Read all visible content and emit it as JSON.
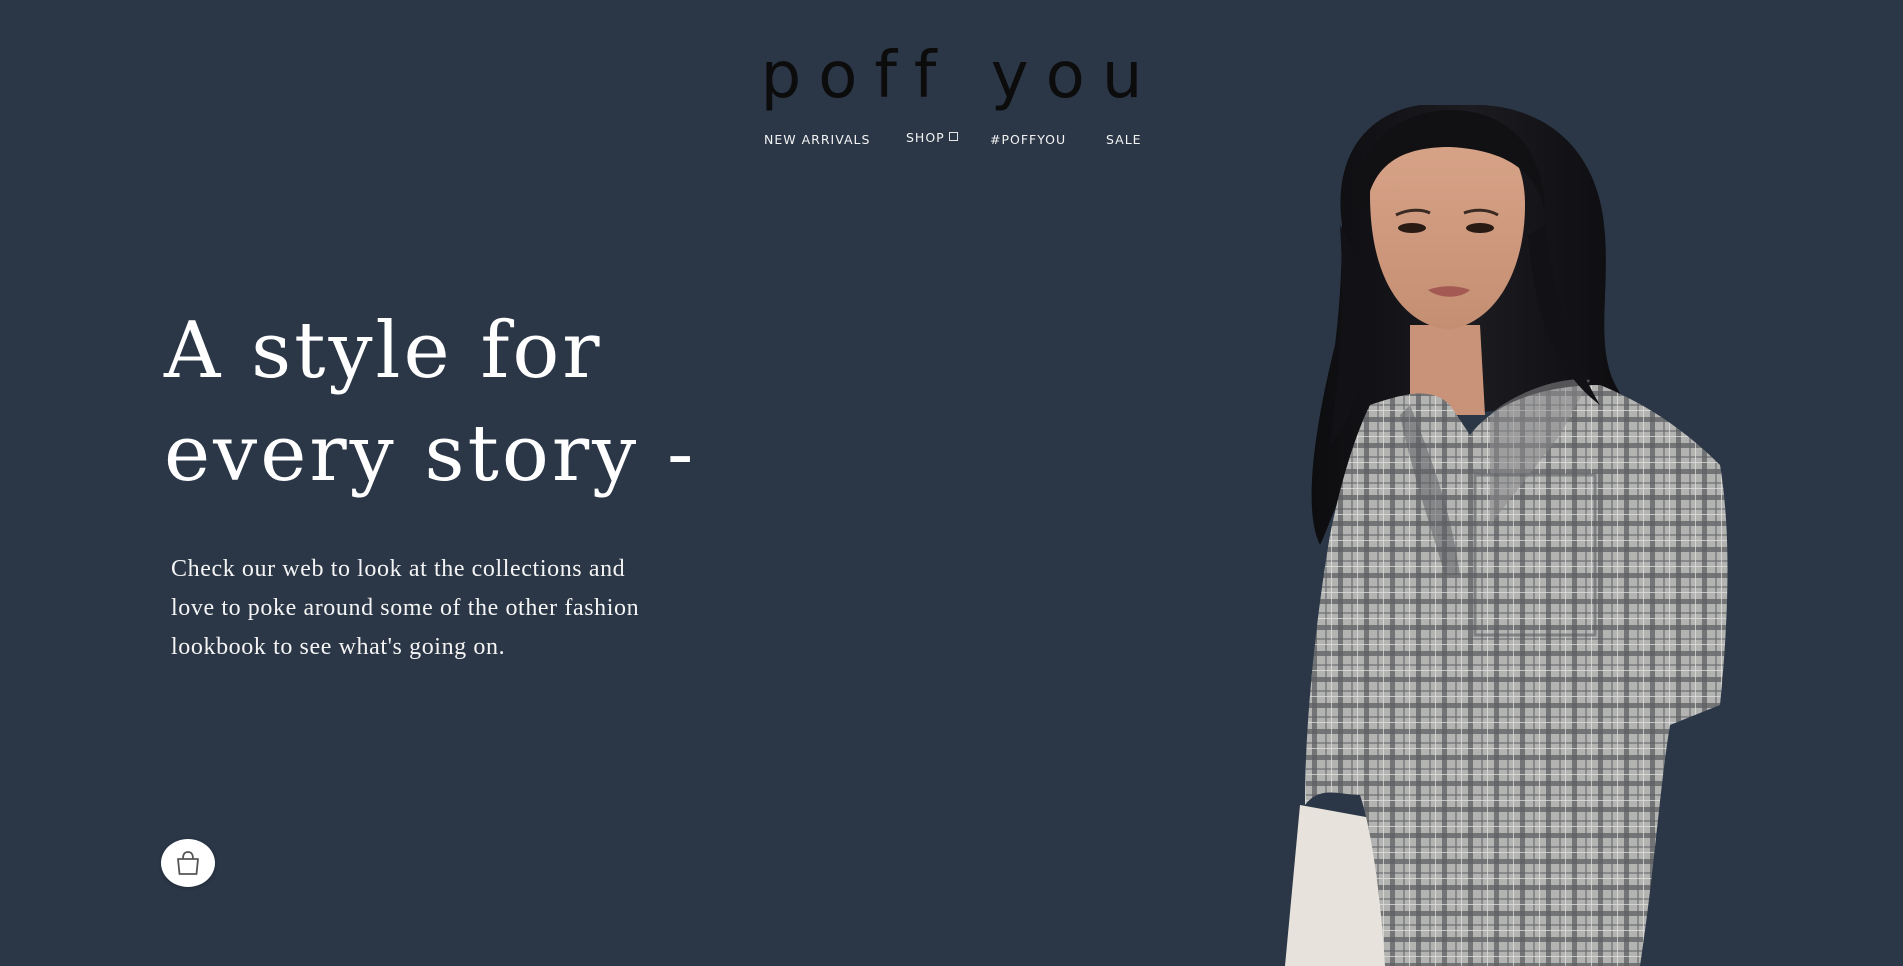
{
  "brand": {
    "logo_text": "poff you"
  },
  "nav": {
    "items": [
      {
        "label": "NEW ARRIVALS"
      },
      {
        "label": "SHOP",
        "has_dropdown": true
      },
      {
        "label": "#POFFYOU"
      },
      {
        "label": "SALE"
      }
    ]
  },
  "hero": {
    "headline_line1": "A style for",
    "headline_line2": "every story -",
    "lead_line1": "Check our web to look at the collections and",
    "lead_line2": "love to poke around some of the other fashion",
    "lead_line3": "lookbook to see what's going on."
  },
  "cart": {
    "icon": "shopping-bag-icon"
  },
  "colors": {
    "background": "#2b3747",
    "logo": "#0c0c0c",
    "text": "#ffffff"
  }
}
